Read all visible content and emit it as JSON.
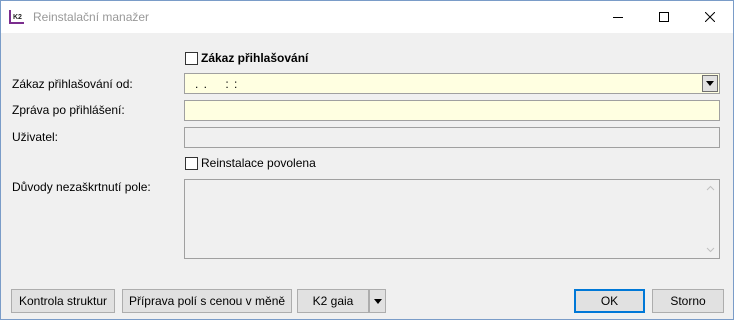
{
  "window": {
    "title": "Reinstalační manažer"
  },
  "form": {
    "ban_login_label": "Zákaz přihlašování",
    "ban_from_label": "Zákaz přihlašování od:",
    "ban_from_value": ". .    : :",
    "message_label": "Zpráva po přihlášení:",
    "message_value": "",
    "user_label": "Uživatel:",
    "user_value": "",
    "reinstall_label": "Reinstalace povolena",
    "reasons_label": "Důvody nezaškrtnutí pole:",
    "reasons_value": ""
  },
  "buttons": {
    "check_structures": "Kontrola struktur",
    "prepare_fields": "Příprava polí s cenou v měně",
    "k2gaia": "K2 gaia",
    "ok": "OK",
    "cancel": "Storno"
  },
  "colors": {
    "input_yellow": "#ffffe1",
    "accent": "#0078d7"
  }
}
